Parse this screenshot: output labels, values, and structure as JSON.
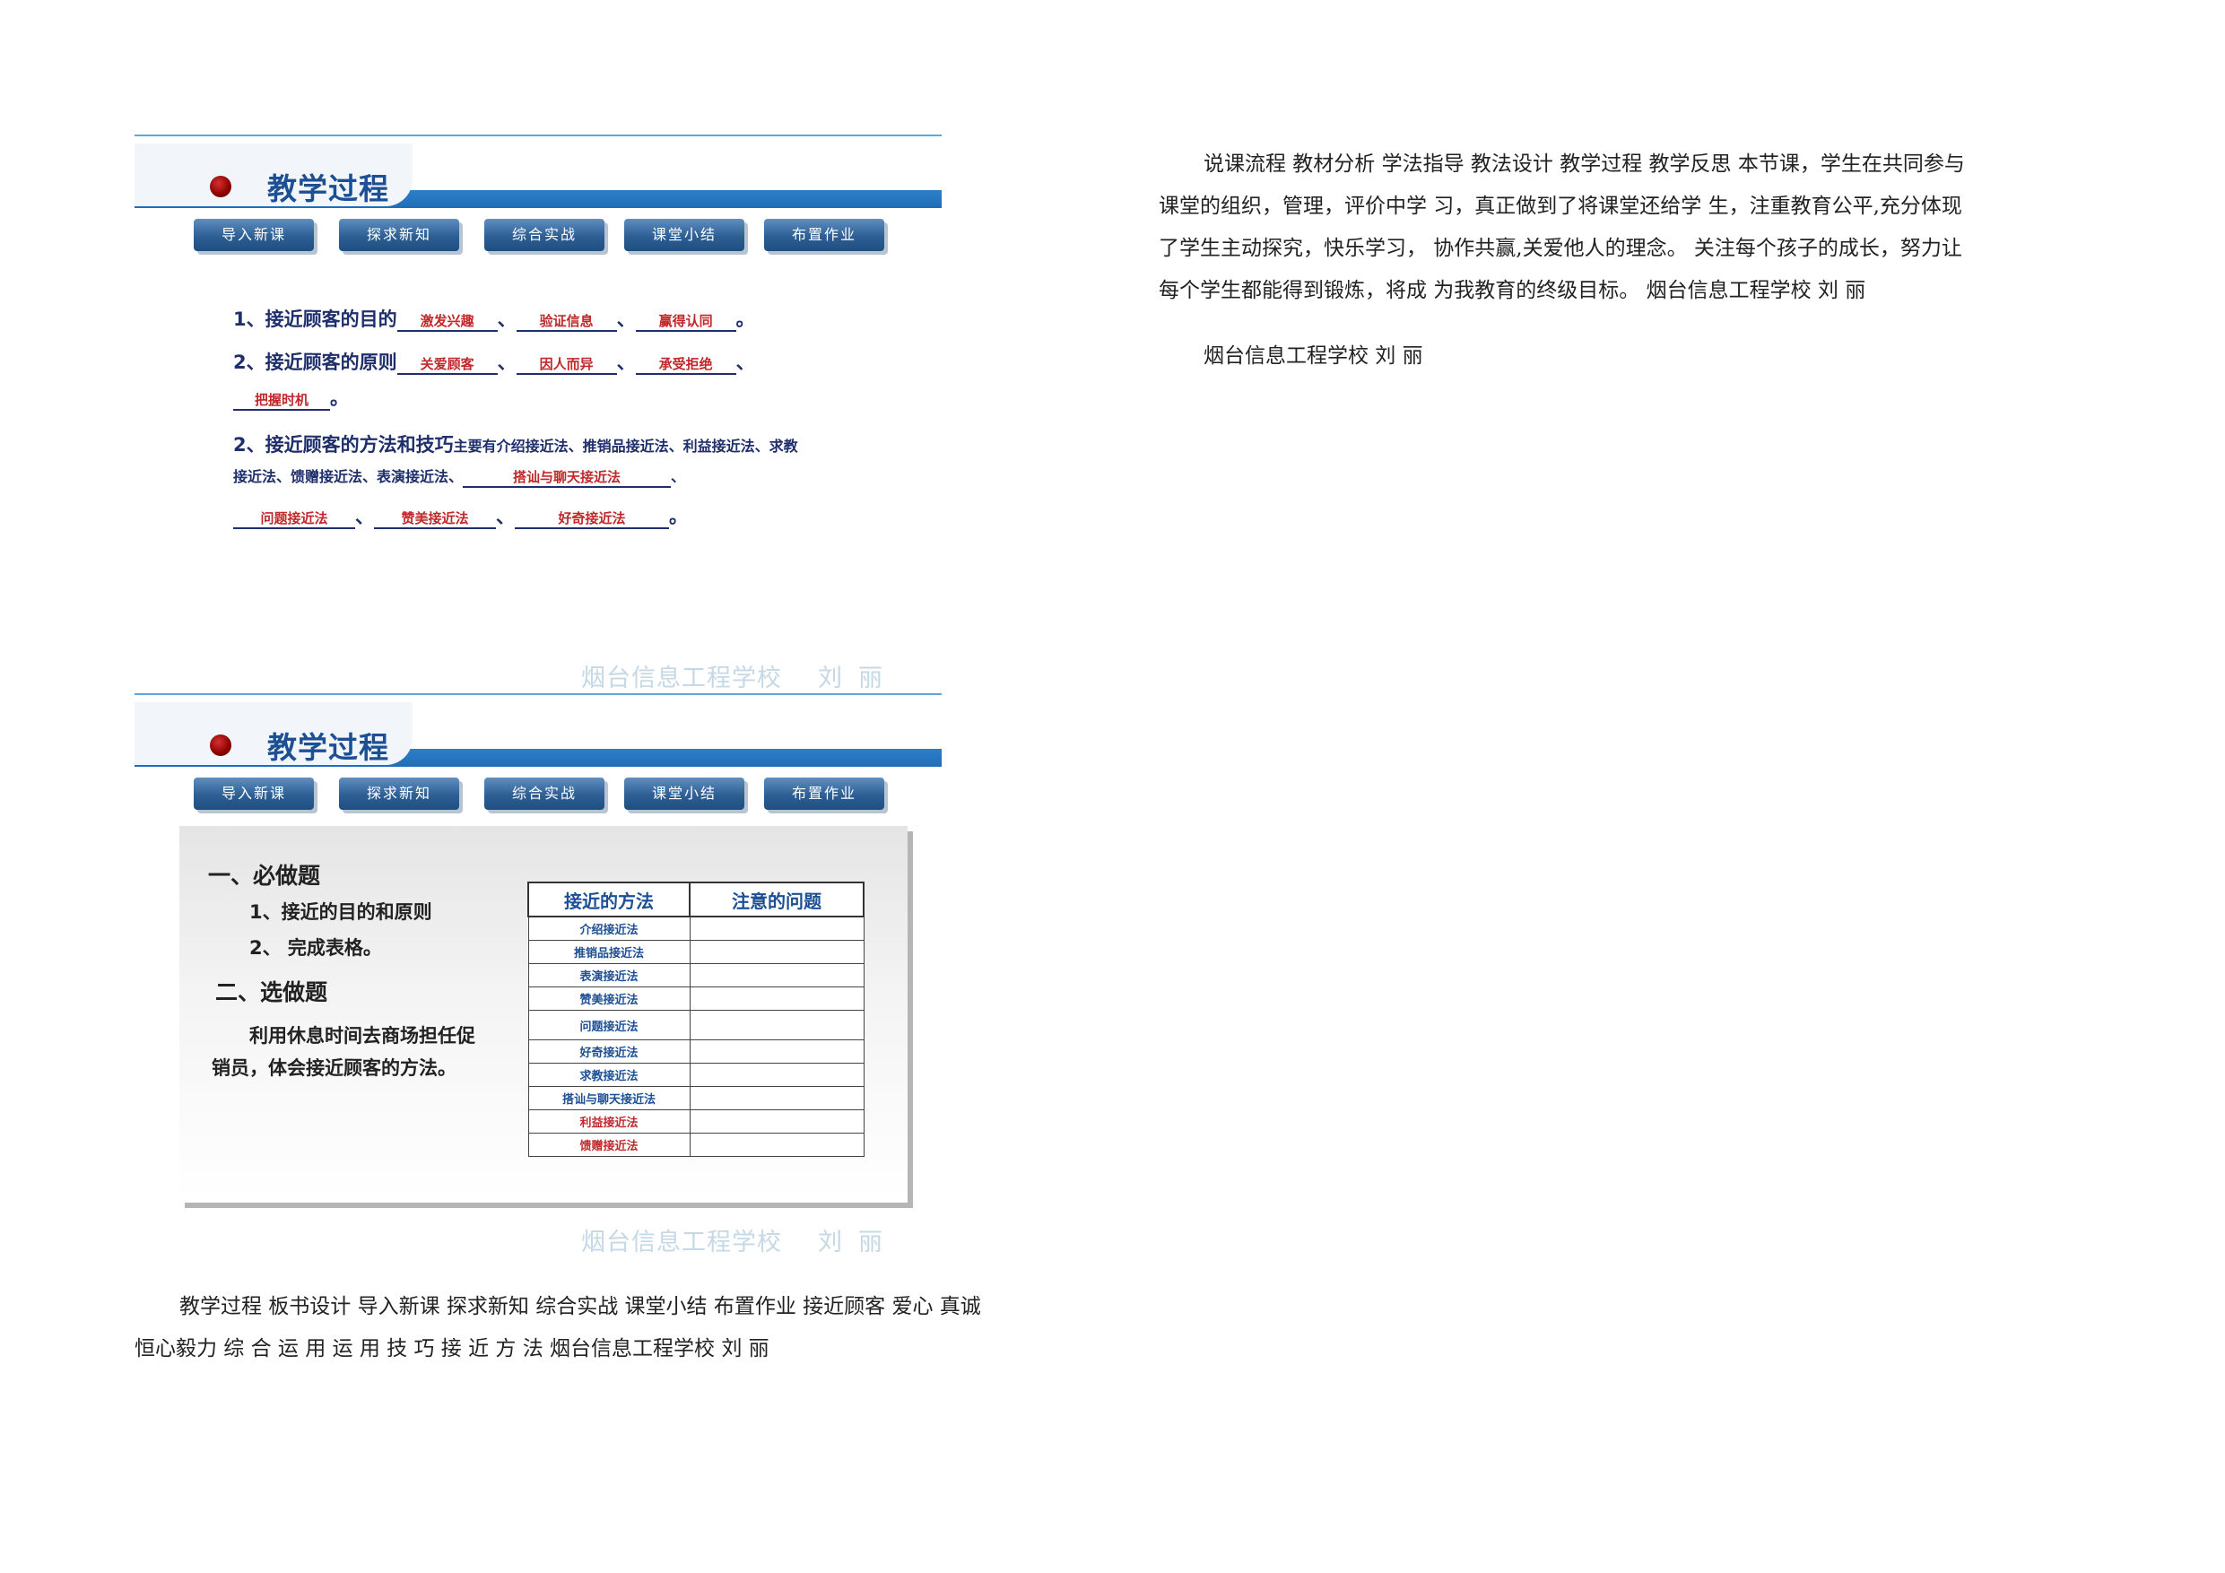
{
  "slide1": {
    "title": "教学过程",
    "nav": [
      "导入新课",
      "探求新知",
      "综合实战",
      "课堂小结",
      "布置作业"
    ],
    "line1_label": "1、接近顾客的目的",
    "line1_blanks": [
      "激发兴趣",
      "验证信息",
      "赢得认同"
    ],
    "line2_label": "2、接近顾客的原则",
    "line2_blanks": [
      "关爱顾客",
      "因人而异",
      "承受拒绝"
    ],
    "line2b_blank": "把握时机",
    "line3_label": "2、接近顾客的方法和技巧",
    "line3_rest": "主要有介绍接近法、推销品接近法、利益接近法、求教",
    "line4_text": "接近法、馈赠接近法、表演接近法、",
    "line4_blank": "搭讪与聊天接近法",
    "line5_blanks": [
      "问题接近法",
      "赞美接近法",
      "好奇接近法"
    ],
    "watermark_school": "烟台信息工程学校",
    "watermark_name": "刘丽"
  },
  "slide2": {
    "title": "教学过程",
    "nav": [
      "导入新课",
      "探求新知",
      "综合实战",
      "课堂小结",
      "布置作业"
    ],
    "section1": "一、必做题",
    "item1": "1、接近的目的和原则",
    "item2": "2、 完成表格。",
    "section2": "二、选做题",
    "optional_line1": "利用休息时间去商场担任促",
    "optional_line2": "销员，体会接近顾客的方法。",
    "table_headers": [
      "接近的方法",
      "注意的问题"
    ],
    "table_rows": [
      "介绍接近法",
      "推销品接近法",
      "表演接近法",
      "赞美接近法",
      "问题接近法",
      "好奇接近法",
      "求教接近法",
      "搭讪与聊天接近法",
      "利益接近法",
      "馈赠接近法"
    ],
    "watermark_school": "烟台信息工程学校",
    "watermark_name": "刘丽"
  },
  "bottom_para": {
    "line1": "教学过程 板书设计 导入新课 探求新知 综合实战 课堂小结 布置作业 接近顾客 爱心 真诚",
    "line2": "恒心毅力 综 合 运 用 运 用 技 巧 接 近 方 法 烟台信息工程学校 刘 丽"
  },
  "right_para": {
    "line1": "说课流程 教材分析 学法指导 教法设计 教学过程 教学反思 本节课，学生在共同参与",
    "line2": "课堂的组织，管理，评价中学 习，真正做到了将课堂还给学 生，注重教育公平,充分体现",
    "line3": "了学生主动探究，快乐学习， 协作共赢,关爱他人的理念。 关注每个孩子的成长，努力让",
    "line4": "每个学生都能得到锻炼，将成 为我教育的终级目标。 烟台信息工程学校 刘 丽",
    "line5": "烟台信息工程学校 刘 丽"
  }
}
